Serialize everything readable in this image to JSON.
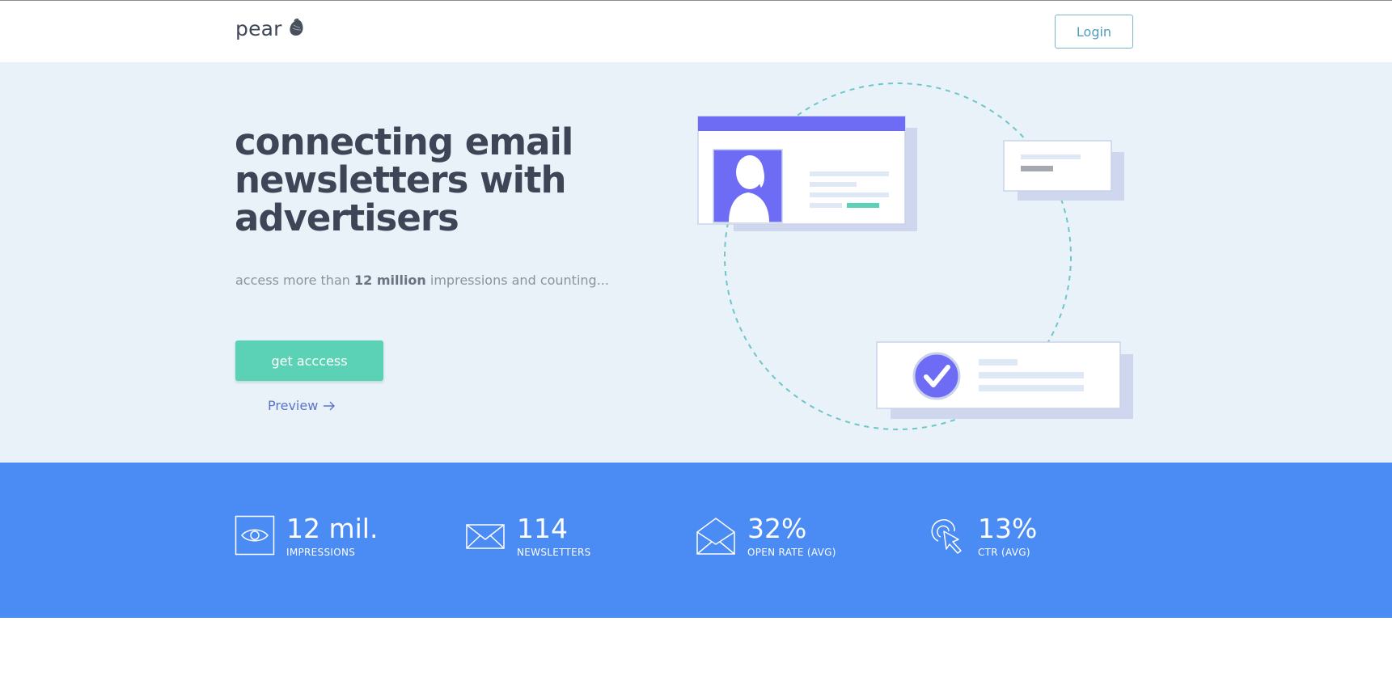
{
  "header": {
    "logo_text": "pear",
    "login_label": "Login"
  },
  "hero": {
    "headline_lines": [
      "connecting email",
      "newsletters with",
      "advertisers"
    ],
    "sub_prefix": "access more than ",
    "sub_bold": "12 million",
    "sub_suffix": " impressions and counting...",
    "cta_label": "get acccess",
    "preview_label": "Preview"
  },
  "stats": [
    {
      "value": "12 mil.",
      "label": "IMPRESSIONS",
      "icon": "eye-icon"
    },
    {
      "value": "114",
      "label": "NEWSLETTERS",
      "icon": "envelope-icon"
    },
    {
      "value": "32%",
      "label": "OPEN RATE (AVG)",
      "icon": "open-envelope-icon"
    },
    {
      "value": "13%",
      "label": "CTR (AVG)",
      "icon": "cursor-click-icon"
    }
  ],
  "colors": {
    "hero_bg": "#e8f2f8",
    "stats_bg": "#4b8bf4",
    "accent_green": "#5bd2b5",
    "accent_purple": "#6b6af5",
    "heading": "#3e4556"
  }
}
